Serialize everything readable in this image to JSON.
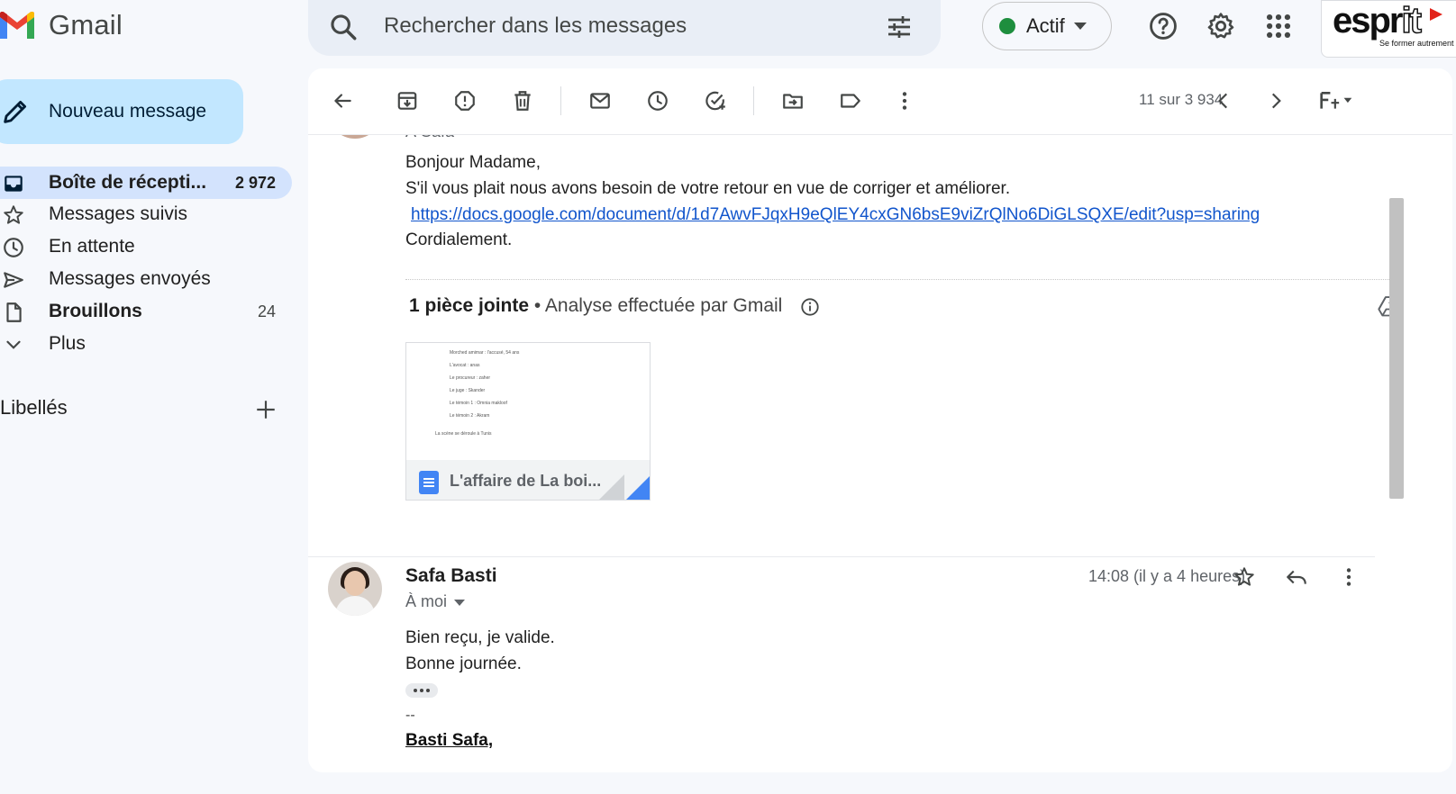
{
  "app": {
    "logo_text": "Gmail"
  },
  "search": {
    "placeholder": "Rechercher dans les messages"
  },
  "status": {
    "label": "Actif",
    "color": "#1e8e3e"
  },
  "brand": {
    "word": "espr",
    "it": "it",
    "tagline": "Se former autrement"
  },
  "sidebar": {
    "compose_label": "Nouveau message",
    "items": [
      {
        "label": "Boîte de récepti...",
        "count": "2 972",
        "icon": "inbox-icon",
        "active": true
      },
      {
        "label": "Messages suivis",
        "count": "",
        "icon": "star-icon"
      },
      {
        "label": "En attente",
        "count": "",
        "icon": "clock-icon"
      },
      {
        "label": "Messages envoyés",
        "count": "",
        "icon": "send-icon"
      },
      {
        "label": "Brouillons",
        "count": "24",
        "icon": "draft-icon"
      },
      {
        "label": "Plus",
        "count": "",
        "icon": "chevron-down-icon"
      }
    ],
    "labels_heading": "Libellés"
  },
  "toolbar": {
    "pager": "11 sur 3 934"
  },
  "thread": {
    "msg1": {
      "to_line": "À Safa",
      "body": [
        "Bonjour Madame,",
        "S'il vous plait nous avons besoin de votre retour en vue de corriger et améliorer.",
        "https://docs.google.com/document/d/1d7AwvFJqxH9eQlEY4cxGN6bsE9viZrQlNo6DiGLSQXE/edit?usp=sharing",
        "Cordialement."
      ],
      "attachment_count": "1 pièce jointe",
      "attachment_scan": " • Analyse effectuée par Gmail",
      "attachment_name": "L'affaire de La boi...",
      "preview_lines": [
        "Morched amimar : l'accusé, 54 ans",
        "L'avocat : anas",
        "Le procureur : zaher",
        "Le juge : Skander",
        "Le témoin 1 : Omnia makloof",
        "Le témoin 2 : Akram",
        "La scène se déroule à Tunis"
      ]
    },
    "msg2": {
      "sender": "Safa Basti",
      "to_line": "À moi",
      "time": "14:08 (il y a 4 heures)",
      "body": [
        "Bien reçu, je valide.",
        "Bonne journée."
      ],
      "sig_dash": "--",
      "sig_name": "Basti Safa,"
    }
  }
}
